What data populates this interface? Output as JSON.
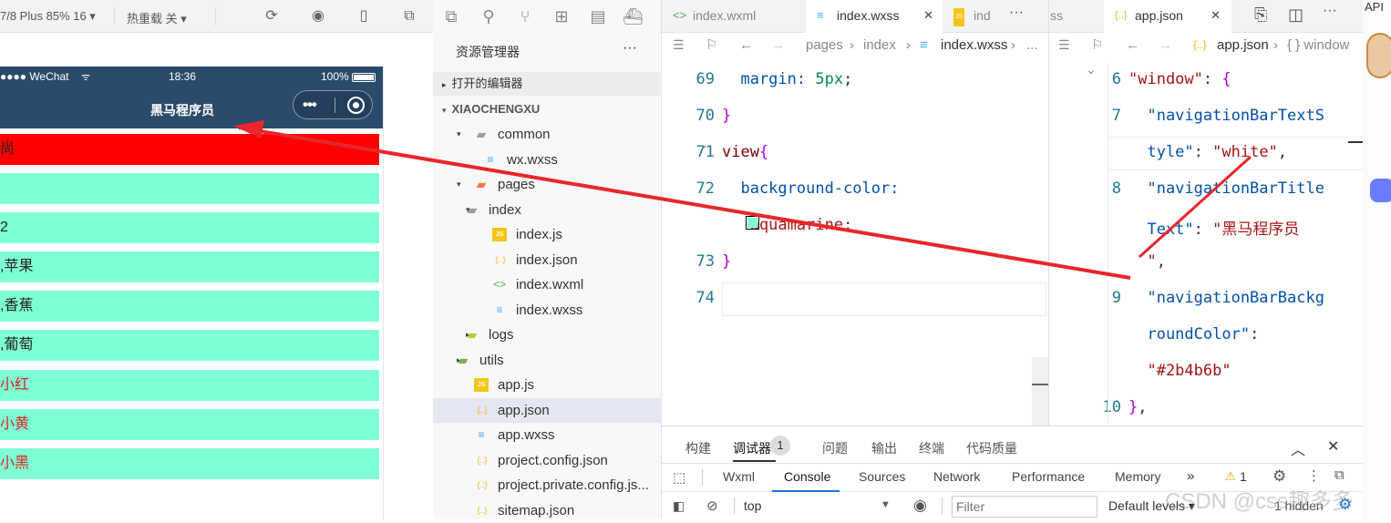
{
  "simulator": {
    "device_label": "7/8 Plus 85% 16 ▾",
    "hot_reload_label": "热重载 关 ▾",
    "status": {
      "signal": "●●●● WeChat",
      "time": "18:36",
      "battery": "100%"
    },
    "nav_title": "黑马程序员",
    "rows": [
      {
        "text": "尚",
        "bg": "#ff0000",
        "color": "#222222"
      },
      {
        "text": "",
        "bg": "#7fffd4",
        "color": "#222222"
      },
      {
        "text": "2",
        "bg": "#7fffd4",
        "color": "#222222"
      },
      {
        "text": ",苹果",
        "bg": "#7fffd4",
        "color": "#222222"
      },
      {
        "text": ",香蕉",
        "bg": "#7fffd4",
        "color": "#222222"
      },
      {
        "text": ",葡萄",
        "bg": "#7fffd4",
        "color": "#222222"
      },
      {
        "text": "小红",
        "bg": "#7fffd4",
        "color": "#e02020"
      },
      {
        "text": "小黄",
        "bg": "#7fffd4",
        "color": "#e02020"
      },
      {
        "text": "小黑",
        "bg": "#7fffd4",
        "color": "#e02020"
      }
    ]
  },
  "explorer": {
    "title": "资源管理器",
    "more": "···",
    "open_editors": "打开的编辑器",
    "project": "XIAOCHENGXU",
    "tree": [
      {
        "label": "common",
        "icon": "folder-icon",
        "glyph": "▰",
        "color": "#90a4ae",
        "chev": "▾"
      },
      {
        "label": "wx.wxss",
        "icon": "css-file-icon",
        "glyph": "≡",
        "color": "#42a5f5",
        "chev": ""
      },
      {
        "label": "pages",
        "icon": "pages-folder-icon",
        "glyph": "▰",
        "color": "#ff7043",
        "chev": "▾"
      },
      {
        "label": "index",
        "icon": "folder-icon",
        "glyph": "▰",
        "color": "#90a4ae",
        "chev": "▾"
      },
      {
        "label": "index.js",
        "icon": "js-file-icon",
        "glyph": "JS",
        "color": "#f5c518",
        "chev": ""
      },
      {
        "label": "index.json",
        "icon": "json-file-icon",
        "glyph": "{..}",
        "color": "#f5b400",
        "chev": ""
      },
      {
        "label": "index.wxml",
        "icon": "wxml-file-icon",
        "glyph": "<>",
        "color": "#4caf50",
        "chev": ""
      },
      {
        "label": "index.wxss",
        "icon": "css-file-icon",
        "glyph": "≡",
        "color": "#42a5f5",
        "chev": ""
      },
      {
        "label": "logs",
        "icon": "folder-icon",
        "glyph": "▰",
        "color": "#c0ca33",
        "chev": "▸"
      },
      {
        "label": "utils",
        "icon": "folder-icon",
        "glyph": "▰",
        "color": "#7cb342",
        "chev": "▸"
      },
      {
        "label": "app.js",
        "icon": "js-file-icon",
        "glyph": "JS",
        "color": "#f5c518",
        "chev": ""
      },
      {
        "label": "app.json",
        "icon": "json-file-icon",
        "glyph": "{..}",
        "color": "#f5b400",
        "chev": "",
        "selected": true
      },
      {
        "label": "app.wxss",
        "icon": "css-file-icon",
        "glyph": "≡",
        "color": "#42a5f5",
        "chev": ""
      },
      {
        "label": "project.config.json",
        "icon": "json-file-icon",
        "glyph": "{..}",
        "color": "#f5b400",
        "chev": ""
      },
      {
        "label": "project.private.config.js...",
        "icon": "json-file-icon",
        "glyph": "{..}",
        "color": "#f5b400",
        "chev": ""
      },
      {
        "label": "sitemap.json",
        "icon": "json-file-icon",
        "glyph": "{..}",
        "color": "#f5b400",
        "chev": ""
      }
    ]
  },
  "editor1": {
    "tabs": [
      {
        "label": "index.wxml",
        "glyph": "<>",
        "color": "#4caf50",
        "active": false
      },
      {
        "label": "index.wxss",
        "glyph": "≡",
        "color": "#42a5f5",
        "active": true,
        "close": "✕"
      },
      {
        "label": "ind",
        "glyph": "JS",
        "color": "#f5c518",
        "active": false
      }
    ],
    "more": "···",
    "breadcrumb": [
      "pages",
      "index",
      "index.wxss",
      "..."
    ],
    "lines": [
      {
        "n": "69",
        "parts": [
          {
            "t": "  margin: ",
            "c": "kw"
          },
          {
            "t": "5px",
            "c": "num"
          },
          {
            "t": ";",
            "c": ""
          }
        ]
      },
      {
        "n": "70",
        "parts": [
          {
            "t": "}",
            "c": "br"
          }
        ]
      },
      {
        "n": "71",
        "parts": [
          {
            "t": "view",
            "c": "sel-c"
          },
          {
            "t": "{",
            "c": "br"
          }
        ]
      },
      {
        "n": "72",
        "parts": [
          {
            "t": "  background-color:",
            "c": "kw"
          }
        ]
      },
      {
        "n": "",
        "parts": [
          {
            "t": "   aquamarine",
            "c": "str"
          },
          {
            "t": ";",
            "c": ""
          }
        ]
      },
      {
        "n": "73",
        "parts": [
          {
            "t": "}",
            "c": "br"
          }
        ]
      },
      {
        "n": "74",
        "parts": []
      }
    ],
    "swatch": "#7fffd4"
  },
  "editor2": {
    "tab": {
      "label": "app.json",
      "glyph": "{..}",
      "color": "#f5b400",
      "close": "✕"
    },
    "more_tab": "ss",
    "breadcrumb": [
      "app.json",
      "{ } window"
    ],
    "lines": [
      {
        "n": "6",
        "parts": [
          {
            "t": "\"window\"",
            "c": "str"
          },
          {
            "t": ": ",
            "c": ""
          },
          {
            "t": "{",
            "c": "br"
          }
        ]
      },
      {
        "n": "7",
        "parts": [
          {
            "t": "  \"navigationBarTextS",
            "c": "kw"
          }
        ]
      },
      {
        "n": "",
        "parts": [
          {
            "t": "  tyle\"",
            "c": "kw"
          },
          {
            "t": ": ",
            "c": ""
          },
          {
            "t": "\"white\"",
            "c": "str"
          },
          {
            "t": ",",
            "c": ""
          }
        ]
      },
      {
        "n": "8",
        "parts": [
          {
            "t": "  \"navigationBarTitle",
            "c": "kw"
          }
        ]
      },
      {
        "n": "",
        "parts": [
          {
            "t": "  Text\"",
            "c": "kw"
          },
          {
            "t": ": ",
            "c": ""
          },
          {
            "t": "\"黑马程序员",
            "c": "str"
          }
        ]
      },
      {
        "n": "",
        "parts": [
          {
            "t": "  \"",
            "c": "str"
          },
          {
            "t": ",",
            "c": ""
          }
        ]
      },
      {
        "n": "9",
        "parts": [
          {
            "t": "  \"navigationBarBackg",
            "c": "kw"
          }
        ]
      },
      {
        "n": "",
        "parts": [
          {
            "t": "  roundColor\"",
            "c": "kw"
          },
          {
            "t": ":",
            "c": ""
          }
        ]
      },
      {
        "n": "",
        "parts": [
          {
            "t": "  \"#2b4b6b\"",
            "c": "str"
          }
        ]
      },
      {
        "n": "10",
        "parts": [
          {
            "t": "}",
            "c": "br"
          },
          {
            "t": ",",
            "c": ""
          }
        ]
      }
    ]
  },
  "panel": {
    "tabs": [
      "构建",
      "调试器",
      "问题",
      "输出",
      "终端",
      "代码质量"
    ],
    "debugger_badge": "1",
    "devtools_tabs": [
      "Wxml",
      "Console",
      "Sources",
      "Network",
      "Performance",
      "Memory"
    ],
    "more": "»",
    "warn_count": "1",
    "context": "top",
    "filter_placeholder": "Filter",
    "levels": "Default levels ▾",
    "hidden": "1 hidden"
  },
  "right": {
    "api_label": "API"
  },
  "watermark": "CSDN @css趣多多",
  "colors": {
    "nav_bg": "#2b4b6b",
    "row_bg": "#7fffd4",
    "arrow": "#e8262b",
    "accent": "#007acc"
  }
}
